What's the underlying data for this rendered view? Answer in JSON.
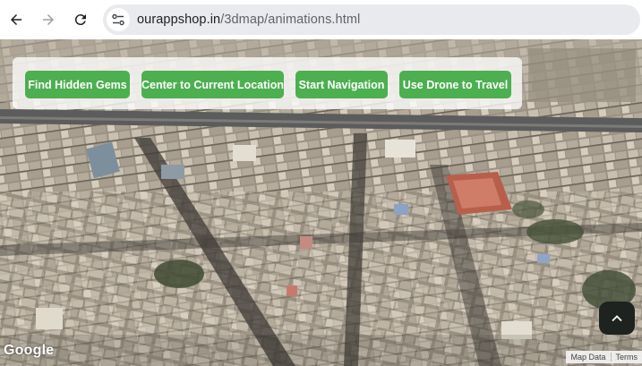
{
  "browser": {
    "url_host": "ourappshop.in",
    "url_path": "/3dmap/animations.html",
    "icons": [
      "back-arrow-icon",
      "forward-arrow-icon",
      "reload-icon",
      "site-info-icon"
    ]
  },
  "controls": {
    "find_hidden_gems": "Find Hidden Gems",
    "center_location": "Center to Current Location",
    "start_navigation": "Start Navigation",
    "drone_travel": "Use Drone to Travel",
    "button_color": "#4caf50"
  },
  "map": {
    "logo": "Google",
    "attribution_data": "Map Data",
    "attribution_terms": "Terms"
  }
}
